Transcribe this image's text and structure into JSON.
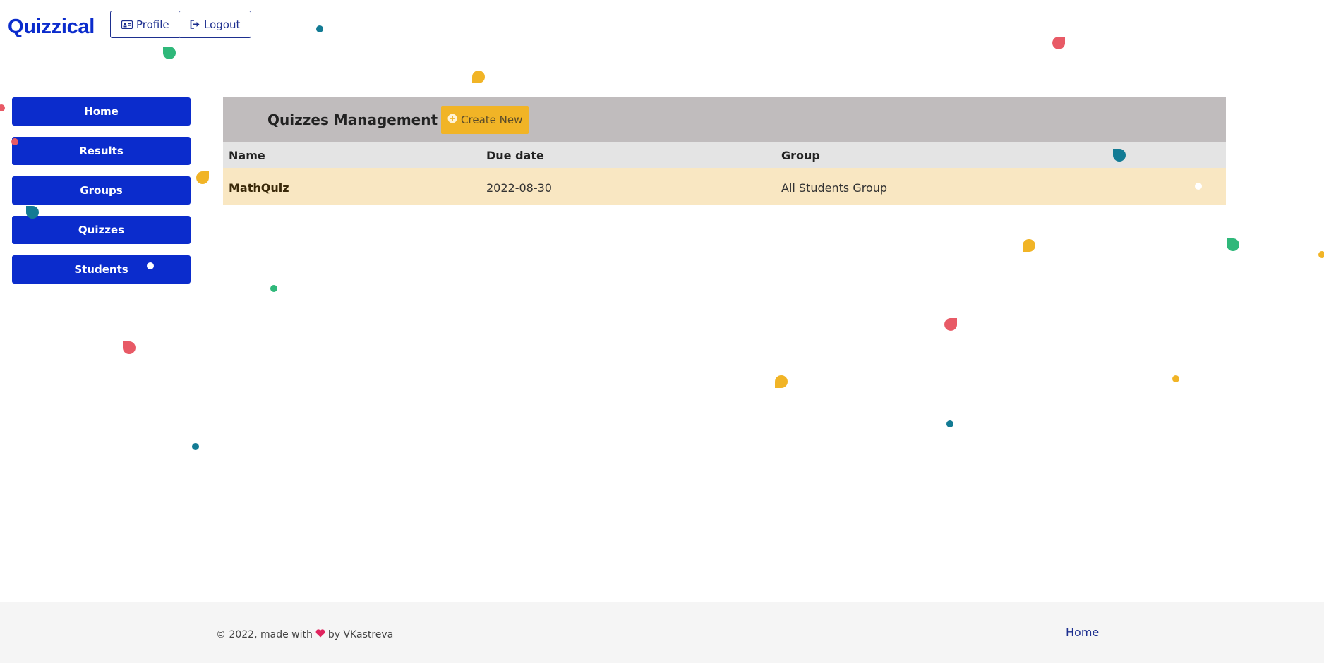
{
  "app": {
    "brand": "Quizzical"
  },
  "header": {
    "profile_label": "Profile",
    "logout_label": "Logout"
  },
  "sidebar": {
    "items": [
      {
        "label": "Home"
      },
      {
        "label": "Results"
      },
      {
        "label": "Groups"
      },
      {
        "label": "Quizzes"
      },
      {
        "label": "Students"
      }
    ]
  },
  "main": {
    "title": "Quizzes Management",
    "create_label": "Create New",
    "table": {
      "columns": [
        "Name",
        "Due date",
        "Group"
      ],
      "rows": [
        {
          "name": "MathQuiz",
          "due_date": "2022-08-30",
          "group": "All Students Group"
        }
      ]
    }
  },
  "footer": {
    "copyright_prefix": "© 2022, made with",
    "copyright_suffix": "by VKastreva",
    "link_label": "Home"
  },
  "icons": {
    "profile": "id-card-icon",
    "logout": "sign-out-icon",
    "create": "plus-circle-icon",
    "heart": "heart-icon"
  },
  "colors": {
    "brand": "#0b2ccc",
    "accent": "#f1b426",
    "header_bg": "#c0bcbd",
    "row_bg": "#f9e7c2",
    "heart": "#e0245e"
  }
}
